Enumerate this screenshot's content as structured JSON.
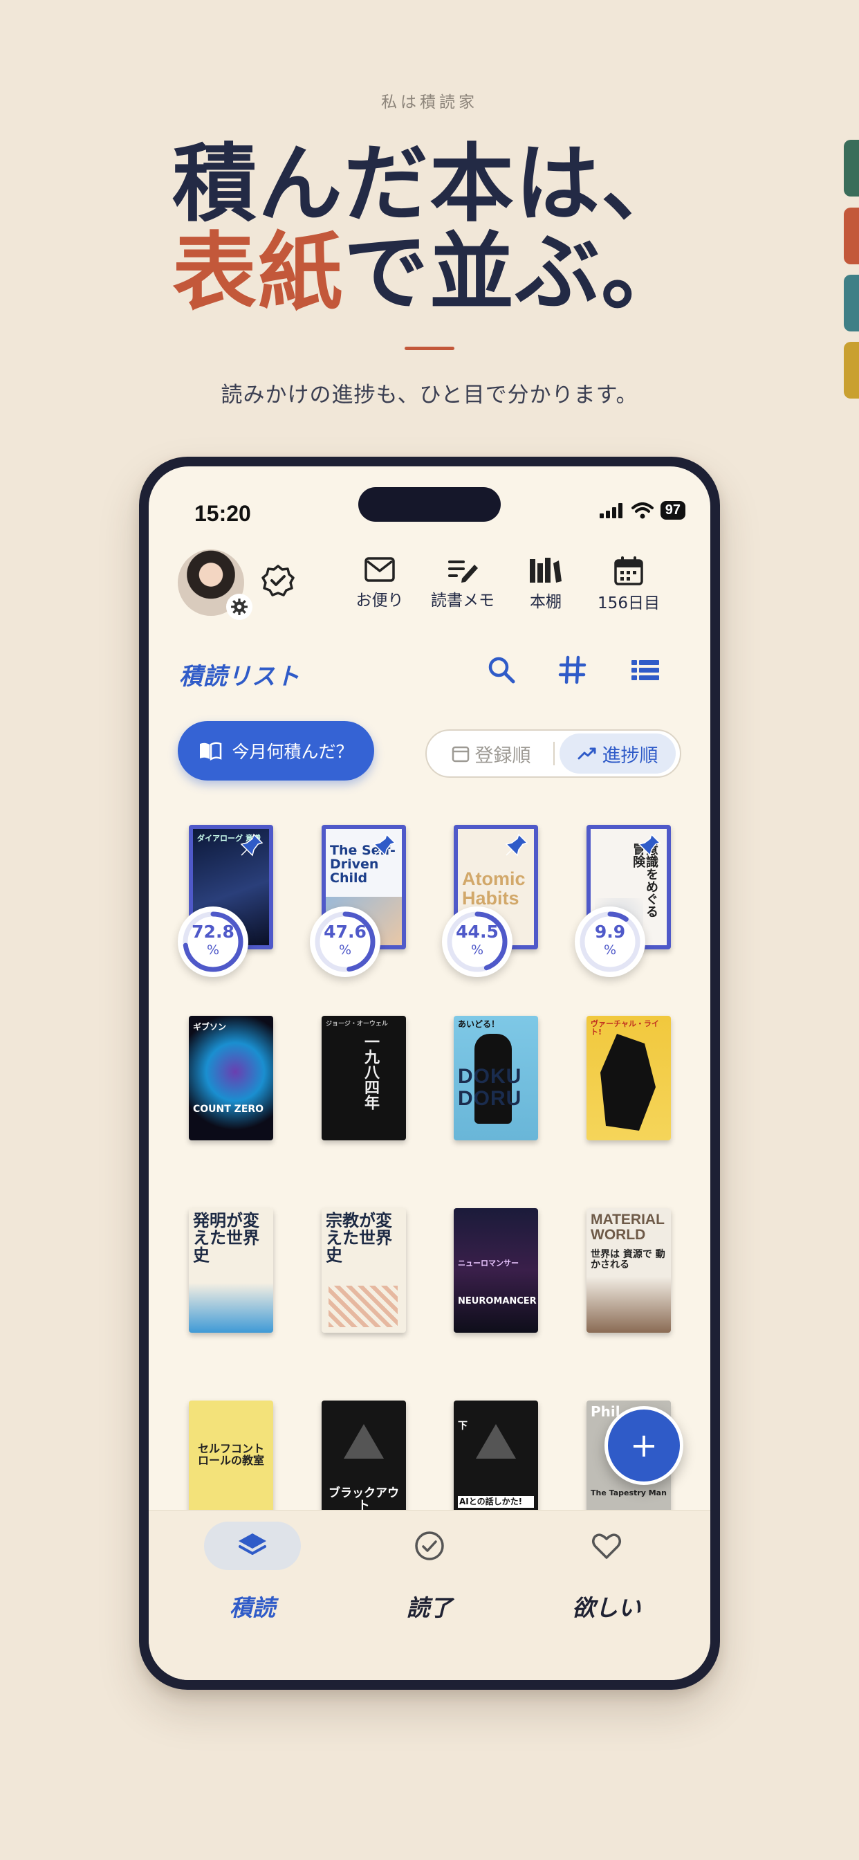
{
  "hero": {
    "eyebrow": "私は積読家",
    "line1": "積んだ本は、",
    "line2_accent": "表紙",
    "line2_rest": "で並ぶ。",
    "subtitle": "読みかけの進捗も、ひと目で分かります。"
  },
  "colors": {
    "accent_orange": "#c3583a",
    "navy": "#232a45",
    "primary_blue": "#2f5bc8",
    "progress_indigo": "#4f59c9",
    "side_tabs": [
      "#3a6d5a",
      "#c3583a",
      "#3f7f86",
      "#c9a030"
    ]
  },
  "status_bar": {
    "time": "15:20",
    "battery": "97"
  },
  "top_nav": {
    "mail_label": "お便り",
    "notes_label": "読書メモ",
    "shelf_label": "本棚",
    "days_label": "156日目"
  },
  "list_header": {
    "title": "積読リスト",
    "icons": [
      "search-icon",
      "hashtag-icon",
      "list-view-icon"
    ]
  },
  "actions": {
    "month_button": "今月何積んだ？",
    "sort_registered": "登録順",
    "sort_progress": "進捗順",
    "active_sort": "進捗順"
  },
  "books": [
    {
      "title": "ダイアローグ 意識",
      "progress": 72.8,
      "pinned": true
    },
    {
      "title": "The Self-Driven Child",
      "progress": 47.6,
      "pinned": true
    },
    {
      "title": "Atomic Habits",
      "progress": 44.5,
      "pinned": true
    },
    {
      "title": "意識をめぐる冒険",
      "progress": 9.9,
      "pinned": true
    },
    {
      "title": "COUNT ZERO",
      "author": "ギブソン"
    },
    {
      "title": "一九八四年",
      "author": "ジョージ・オーウェル"
    },
    {
      "title": "DOKUDORU",
      "top": "あいどる！"
    },
    {
      "title": "ヴァーチャル・ライト",
      "top": "ヴァーチャル・ライト!"
    },
    {
      "title": "発明が変えた世界史"
    },
    {
      "title": "宗教が変えた世界史"
    },
    {
      "title": "NEUROMANCER",
      "sub": "ニューロマンサー"
    },
    {
      "title": "MATERIAL WORLD",
      "sub": "世界は 資源で 動かされる"
    },
    {
      "title": "セルフコントロールの教室"
    },
    {
      "title": "ブラックアウト"
    },
    {
      "title": "AIとの話しかた!",
      "sub": "下"
    },
    {
      "title": "Phil",
      "sub": "The Tapestry Man"
    }
  ],
  "progress_unit": "%",
  "fab_label": "+",
  "bottom_tabs": [
    {
      "label": "積読",
      "icon": "stack-icon",
      "active": true
    },
    {
      "label": "読了",
      "icon": "check-circle-icon",
      "active": false
    },
    {
      "label": "欲しい",
      "icon": "heart-icon",
      "active": false
    }
  ]
}
